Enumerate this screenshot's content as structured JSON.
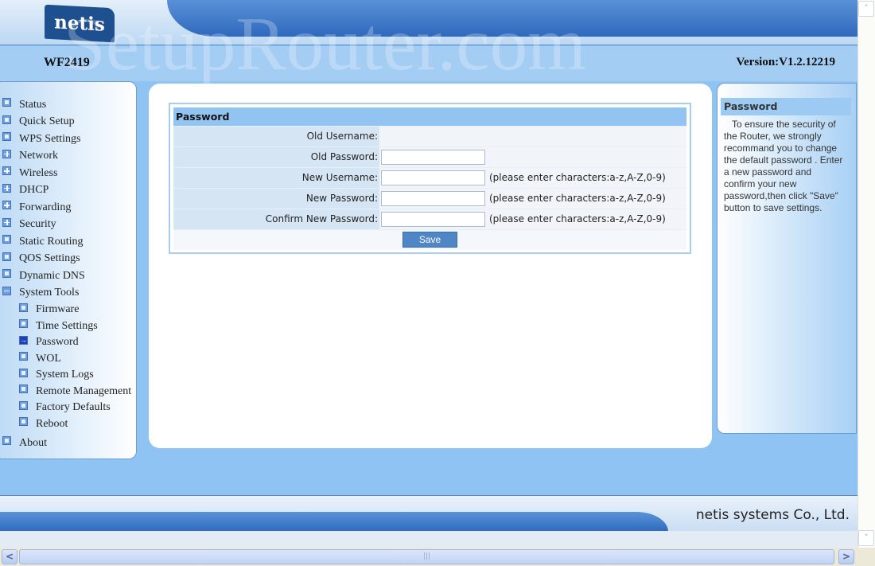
{
  "header": {
    "logo": "netis",
    "model": "WF2419",
    "version": "Version:V1.2.12219",
    "watermark": "SetupRouter.com"
  },
  "sidebar": {
    "items": [
      {
        "label": "Status",
        "icon": "dot",
        "level": 1
      },
      {
        "label": "Quick Setup",
        "icon": "dot",
        "level": 1
      },
      {
        "label": "WPS Settings",
        "icon": "dot",
        "level": 1
      },
      {
        "label": "Network",
        "icon": "plus",
        "level": 1
      },
      {
        "label": "Wireless",
        "icon": "plus",
        "level": 1
      },
      {
        "label": "DHCP",
        "icon": "plus",
        "level": 1
      },
      {
        "label": "Forwarding",
        "icon": "plus",
        "level": 1
      },
      {
        "label": "Security",
        "icon": "plus",
        "level": 1
      },
      {
        "label": "Static Routing",
        "icon": "dot",
        "level": 1
      },
      {
        "label": "QOS Settings",
        "icon": "dot",
        "level": 1
      },
      {
        "label": "Dynamic DNS",
        "icon": "dot",
        "level": 1
      },
      {
        "label": "System Tools",
        "icon": "minus",
        "level": 1
      },
      {
        "label": "Firmware",
        "icon": "dot",
        "level": 2
      },
      {
        "label": "Time Settings",
        "icon": "dot",
        "level": 2
      },
      {
        "label": "Password",
        "icon": "arrow",
        "level": 2,
        "active": true
      },
      {
        "label": "WOL",
        "icon": "dot",
        "level": 2
      },
      {
        "label": "System Logs",
        "icon": "dot",
        "level": 2
      },
      {
        "label": "Remote Management",
        "icon": "dot",
        "level": 2
      },
      {
        "label": "Factory Defaults",
        "icon": "dot",
        "level": 2
      },
      {
        "label": "Reboot",
        "icon": "dot",
        "level": 2
      },
      {
        "label": "About",
        "icon": "dot",
        "level": 1
      }
    ]
  },
  "form": {
    "title": "Password",
    "old_username_label": "Old Username:",
    "old_username_value": "",
    "old_password_label": "Old Password:",
    "new_username_label": "New Username:",
    "new_password_label": "New Password:",
    "confirm_password_label": "Confirm New Password:",
    "hint": "(please enter characters:a-z,A-Z,0-9)",
    "save_label": "Save"
  },
  "help": {
    "title": "Password",
    "text": "To ensure the security of the Router, we strongly recommand you to change the default password . Enter a new password and confirm your new password,then click \"Save\" button to save settings."
  },
  "footer": {
    "company": "netis systems Co., Ltd."
  },
  "scrollbars": {
    "up": "˄",
    "down": "˅",
    "left": "<",
    "right": ">",
    "grip": "|||"
  },
  "colors": {
    "accent": "#2f69bd",
    "background": "#8ec3f4",
    "table_header": "#92c4f2"
  }
}
